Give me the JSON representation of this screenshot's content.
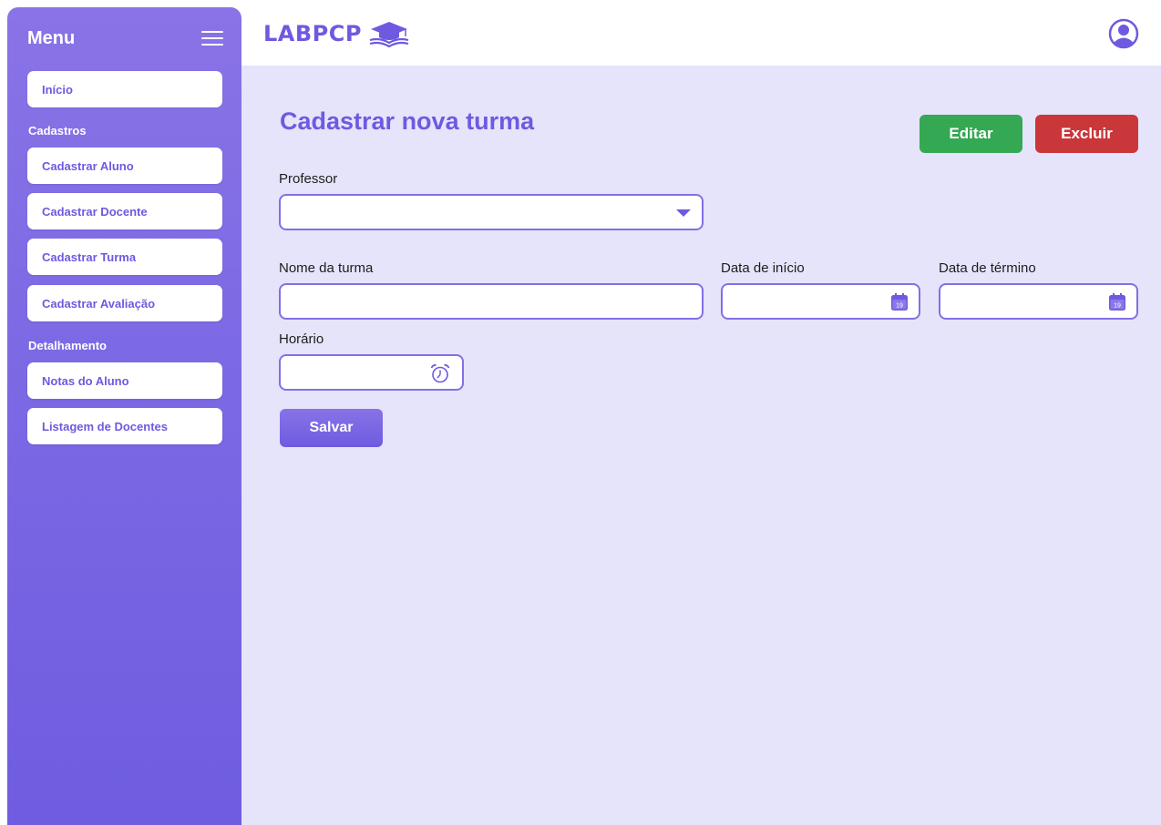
{
  "sidebar": {
    "title": "Menu",
    "home": "Início",
    "section_register": "Cadastros",
    "register_items": [
      "Cadastrar Aluno",
      "Cadastrar Docente",
      "Cadastrar Turma",
      "Cadastrar Avaliação"
    ],
    "section_detail": "Detalhamento",
    "detail_items": [
      "Notas do Aluno",
      "Listagem de Docentes"
    ]
  },
  "header": {
    "logo_text": "LABPCP",
    "logo_icon": "graduation-cap-book-icon",
    "user_icon": "user-circle-icon"
  },
  "page": {
    "title": "Cadastrar nova turma",
    "edit_label": "Editar",
    "delete_label": "Excluir",
    "save_label": "Salvar"
  },
  "form": {
    "professor_label": "Professor",
    "professor_value": "",
    "class_name_label": "Nome da turma",
    "class_name_value": "",
    "start_date_label": "Data de início",
    "start_date_value": "",
    "end_date_label": "Data de término",
    "end_date_value": "",
    "time_label": "Horário",
    "time_value": "",
    "calendar_icon_day": "19"
  },
  "colors": {
    "accent": "#6d5ae0",
    "edit": "#35a853",
    "delete": "#c9373a",
    "background": "#e5e4fb"
  }
}
